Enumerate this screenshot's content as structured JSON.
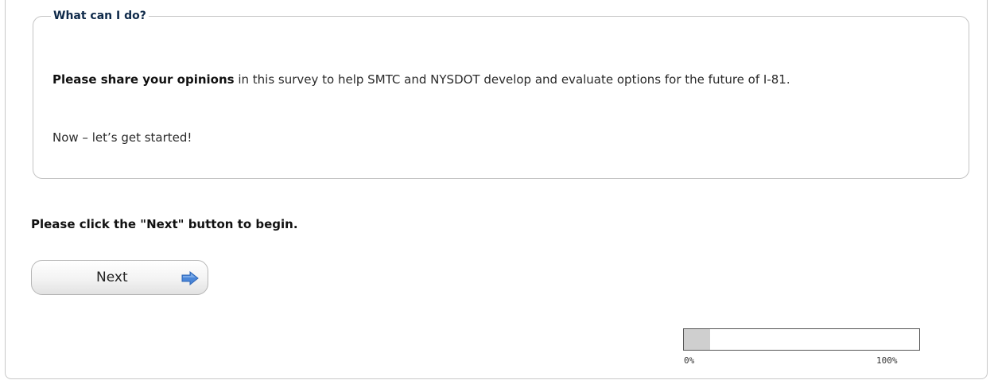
{
  "info_box": {
    "legend": "What can I do?",
    "paragraph_1": {
      "bold_lead": "Please share your opinions",
      "text": " in this survey to help SMTC and NYSDOT develop and evaluate options for the future of I-81."
    },
    "paragraph_2": "Now – let’s get started!"
  },
  "instruction": "Please click the \"Next\" button to begin.",
  "next_button": {
    "label": "Next",
    "icon": "right-arrow-icon",
    "icon_color": "#4a86d8"
  },
  "progress": {
    "value_fraction": 0.11,
    "min_label": "0%",
    "max_label": "100%",
    "fill_color": "#cfcfcf"
  }
}
